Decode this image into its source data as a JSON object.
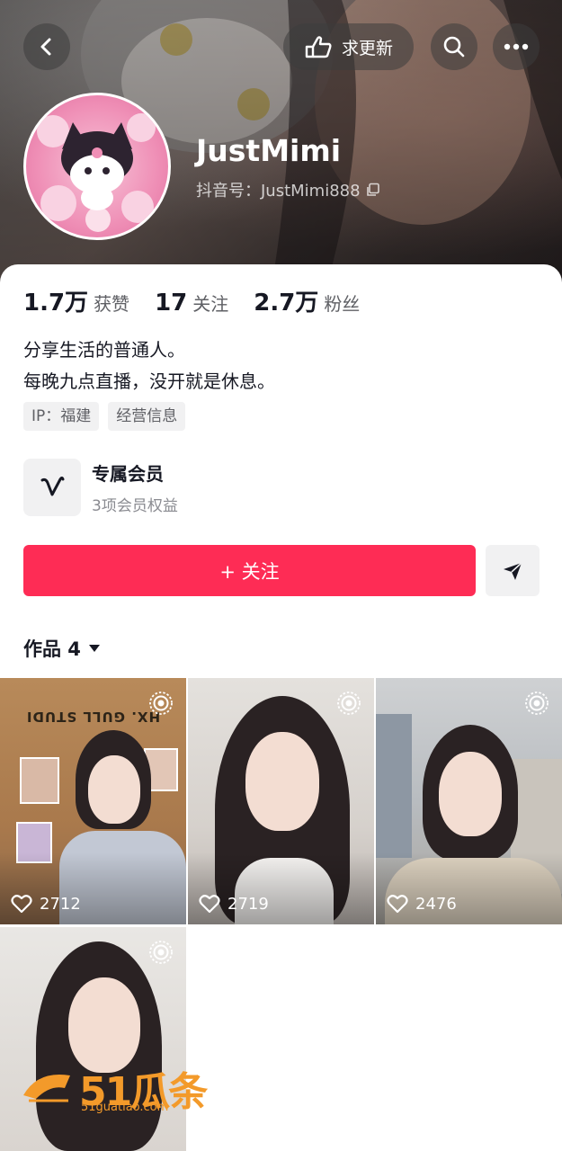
{
  "header": {
    "back_icon": "chevron-left-icon",
    "update_label": "求更新",
    "update_icon": "hand-point-icon",
    "search_icon": "search-icon",
    "more_icon": "more-dots-icon"
  },
  "profile": {
    "username": "JustMimi",
    "douyin_id": "抖音号：JustMimi888",
    "copy_icon": "copy-icon"
  },
  "stats": [
    {
      "num": "1.7万",
      "label": "获赞"
    },
    {
      "num": "17",
      "label": "关注"
    },
    {
      "num": "2.7万",
      "label": "粉丝"
    }
  ],
  "bio": {
    "line1": "分享生活的普通人。",
    "line2": "每晚九点直播，没开就是休息。"
  },
  "tags": [
    "IP：福建",
    "经营信息"
  ],
  "member": {
    "title": "专属会员",
    "subtitle": "3项会员权益"
  },
  "actions": {
    "follow_label": "+ 关注",
    "share_icon": "send-icon"
  },
  "works": {
    "tab_label": "作品 4",
    "items": [
      {
        "likes": "2712"
      },
      {
        "likes": "2719"
      },
      {
        "likes": "2476"
      },
      {
        "likes": ""
      }
    ],
    "studio_sign": "HX. GULL STUDI"
  },
  "watermark": {
    "text": "51瓜条",
    "domain": "51guatiao.com"
  },
  "colors": {
    "accent": "#fe2c55",
    "watermark": "#f39a2a"
  }
}
